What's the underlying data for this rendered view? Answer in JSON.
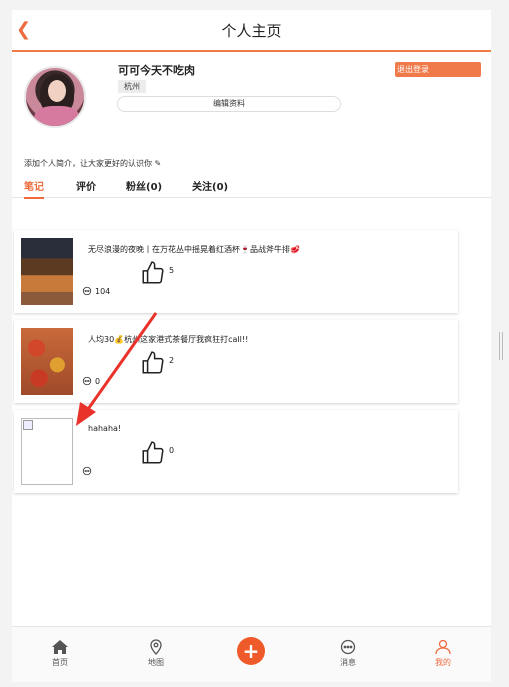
{
  "header": {
    "title": "个人主页",
    "back_icon": "chevron-left-icon"
  },
  "profile": {
    "username": "可可今天不吃肉",
    "city": "杭州",
    "edit_label": "编辑资料",
    "logout_label": "退出登录",
    "bio": "添加个人简介，让大家更好的认识你 ✎"
  },
  "tabs": [
    {
      "label": "笔记",
      "active": true
    },
    {
      "label": "评价",
      "active": false
    },
    {
      "label": "粉丝(0)",
      "active": false
    },
    {
      "label": "关注(0)",
      "active": false
    }
  ],
  "notes": [
    {
      "title": "无尽浪漫的夜晚丨在万花丛中摇晃着红酒杯🍷品战斧牛排🥩",
      "likes": "5",
      "comments": "104"
    },
    {
      "title": "人均30💰杭州这家港式茶餐厅我疯狂打call!!",
      "likes": "2",
      "comments": "0"
    },
    {
      "title": "hahaha!",
      "likes": "0",
      "comments": ""
    }
  ],
  "bottom_nav": [
    {
      "label": "首页",
      "icon": "home-icon"
    },
    {
      "label": "地图",
      "icon": "map-pin-icon"
    },
    {
      "label": "",
      "icon": "plus-icon"
    },
    {
      "label": "消息",
      "icon": "message-icon"
    },
    {
      "label": "我的",
      "icon": "user-icon"
    }
  ],
  "colors": {
    "accent": "#ef6b3d",
    "logout_bg": "#f07a4a",
    "arrow": "#e8322a"
  }
}
